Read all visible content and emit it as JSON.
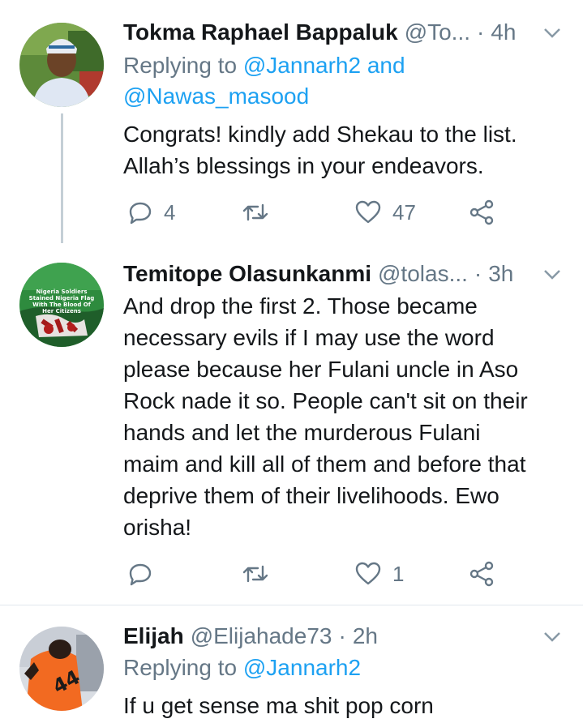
{
  "tweets": [
    {
      "name": "Tokma Raphael Bappaluk",
      "handle": "@To...",
      "dot": "·",
      "time": "4h",
      "replying_prefix": "Replying to",
      "replying_first": "@Jannarh2",
      "replying_and": "and",
      "replying_second": "@Nawas_masood",
      "body_lines": [
        "Congrats!  kindly add Shekau to the list.",
        "Allah’s blessings in your endeavors."
      ],
      "reply_count": "4",
      "retweet_count": "",
      "like_count": "47"
    },
    {
      "name": "Temitope Olasunkanmi",
      "handle": "@tolas...",
      "dot": "·",
      "time": "3h",
      "avatar_caption": [
        "Nigeria Soldiers",
        "Stained Nigeria Flag",
        "With The Blood Of",
        "Her Citizens"
      ],
      "body_lines": [
        "And drop the first 2. Those became",
        "necessary evils if I may use the word",
        "please because her Fulani uncle in Aso",
        "Rock nade it so. People can't sit on their",
        "hands and let the murderous Fulani",
        "maim and kill all of them and before that",
        "deprive them of their livelihoods. Ewo",
        "orisha!"
      ],
      "reply_count": "",
      "retweet_count": "",
      "like_count": "1"
    },
    {
      "name": "Elijah",
      "handle": "@Elijahade73",
      "dot": "·",
      "time": "2h",
      "replying_prefix": "Replying to",
      "replying_first": "@Jannarh2",
      "jersey_number": "44",
      "body_lines": [
        "If u get sense  ma shit pop corn"
      ]
    }
  ],
  "icons": [
    "reply-icon",
    "retweet-icon",
    "like-icon",
    "share-icon",
    "chevron-down-icon"
  ],
  "colors": {
    "link": "#1da1f2",
    "muted": "#657786",
    "text": "#14171a",
    "divider": "#e1e8ed"
  }
}
